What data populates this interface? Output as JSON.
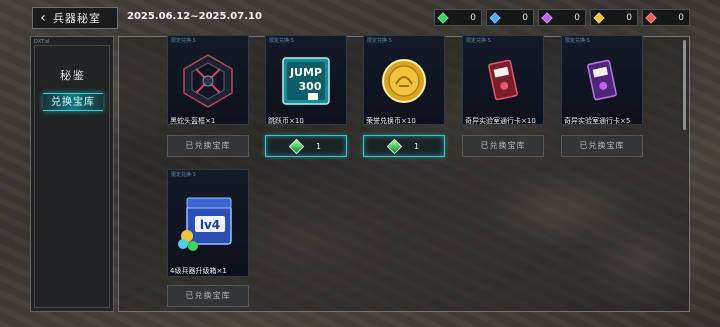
{
  "header": {
    "title": "兵器秘室",
    "date_range": "2025.06.12~2025.07.10"
  },
  "resources": [
    {
      "icon": "green-gem-icon",
      "color": "#3fd45f",
      "value": "0"
    },
    {
      "icon": "blue-gem-icon",
      "color": "#4fa8ff",
      "value": "0"
    },
    {
      "icon": "purple-gem-icon",
      "color": "#c062f0",
      "value": "0"
    },
    {
      "icon": "yellow-gem-icon",
      "color": "#f2c43a",
      "value": "0"
    },
    {
      "icon": "red-gem-icon",
      "color": "#ef5a5a",
      "value": "0"
    }
  ],
  "sidebar": {
    "tiny_label": "DXT.sl",
    "items": [
      {
        "label": "秘鉴"
      },
      {
        "label": "兑换宝库",
        "active": true
      }
    ]
  },
  "items": [
    {
      "tag": "限定兑换·S",
      "name": "黑蛇头盔框×1",
      "icon": "dark-armor-frame-icon",
      "status": "已兑换宝库",
      "state": "done"
    },
    {
      "tag": "限定兑换·S",
      "name": "跳跃币×10",
      "icon": "jump-300-token-icon",
      "jump_text": "JUMP",
      "jump_num": "300",
      "price": "1",
      "state": "buy"
    },
    {
      "tag": "限定兑换·S",
      "name": "荣誉兑换币×10",
      "icon": "gold-coin-icon",
      "price": "1",
      "state": "buy"
    },
    {
      "tag": "限定兑换·S",
      "name": "奇异实验室通行卡×10",
      "icon": "red-keycard-icon",
      "status": "已兑换宝库",
      "state": "done"
    },
    {
      "tag": "限定兑换·S",
      "name": "奇异实验室通行卡×5",
      "icon": "purple-keycard-icon",
      "status": "已兑换宝库",
      "state": "done"
    },
    {
      "tag": "限定兑换·S",
      "name": "4级兵器升级箱×1",
      "icon": "lv4-crate-icon",
      "crate_text": "lv4",
      "status": "已兑换宝库",
      "state": "done"
    }
  ]
}
